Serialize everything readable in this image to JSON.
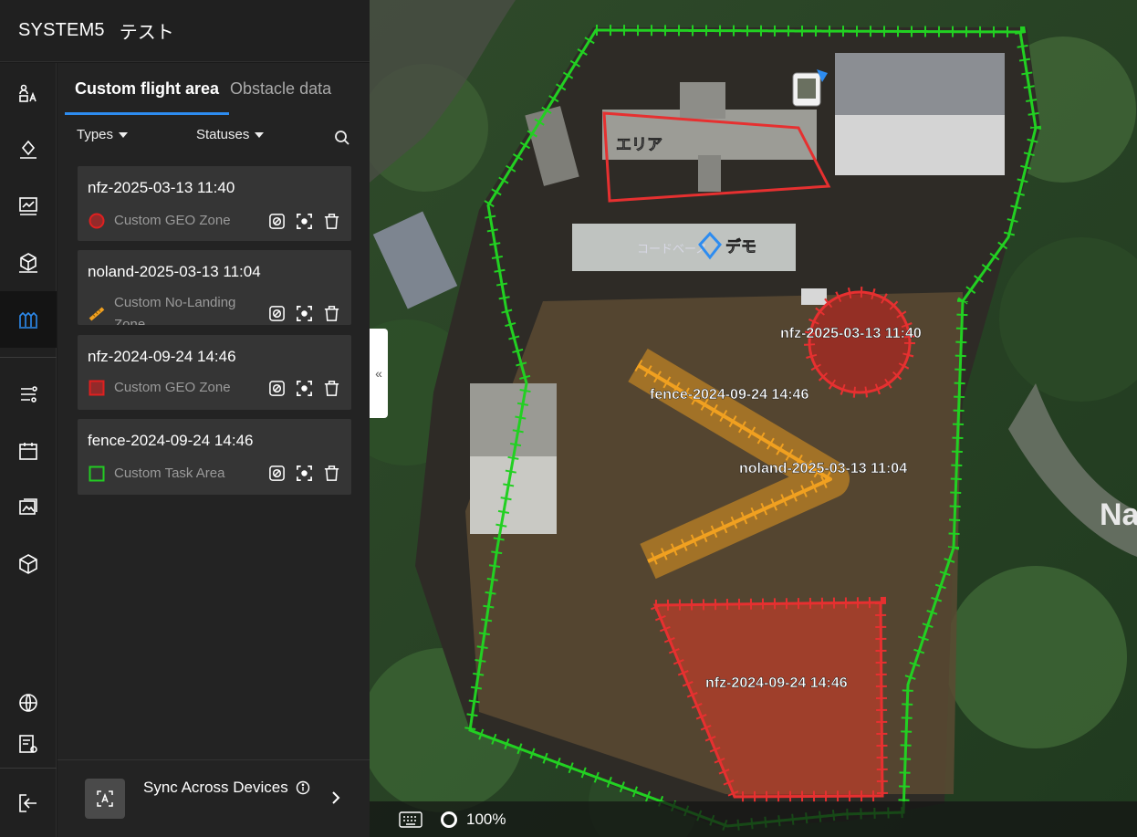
{
  "header": {
    "system_name": "SYSTEM5",
    "project_name": "テスト"
  },
  "rail": {
    "items": [
      {
        "icon": "team-icon"
      },
      {
        "icon": "waypoint-icon"
      },
      {
        "icon": "mission-icon"
      },
      {
        "icon": "model-icon"
      },
      {
        "icon": "flight-area-icon",
        "active": true
      },
      {
        "icon": "route-icon"
      },
      {
        "icon": "calendar-icon"
      },
      {
        "icon": "media-icon"
      },
      {
        "icon": "cube-icon"
      },
      {
        "icon": "globe-icon"
      },
      {
        "icon": "settings-list-icon"
      },
      {
        "icon": "logout-icon"
      }
    ]
  },
  "panel": {
    "tabs": [
      {
        "label": "Custom flight area",
        "active": true
      },
      {
        "label": "Obstacle data",
        "active": false
      }
    ],
    "filters": {
      "types_label": "Types",
      "statuses_label": "Statuses"
    },
    "areas": [
      {
        "name": "nfz-2025-03-13 11:40",
        "type": "Custom GEO Zone",
        "marker": "red-circle",
        "color": "#e02020"
      },
      {
        "name": "noland-2025-03-13 11:04",
        "type": "Custom No-Landing Zone",
        "marker": "orange-line",
        "color": "#f0a020"
      },
      {
        "name": "nfz-2024-09-24 14:46",
        "type": "Custom GEO Zone",
        "marker": "red-square",
        "color": "#e02020"
      },
      {
        "name": "fence-2024-09-24 14:46",
        "type": "Custom Task Area",
        "marker": "green-square",
        "color": "#22cc22"
      }
    ],
    "sync": {
      "label": "Sync Across Devices"
    }
  },
  "map": {
    "labels": {
      "area_label": "エリア",
      "demo_label": "デモ",
      "sign_text": "コードベース",
      "road_text": "Na",
      "nfz_circle": "nfz-2025-03-13 11:40",
      "fence_line": "fence-2024-09-24 14:46",
      "noland_line": "noland-2025-03-13 11:04",
      "nfz_square": "nfz-2024-09-24 14:46"
    },
    "zoom": "100%"
  }
}
